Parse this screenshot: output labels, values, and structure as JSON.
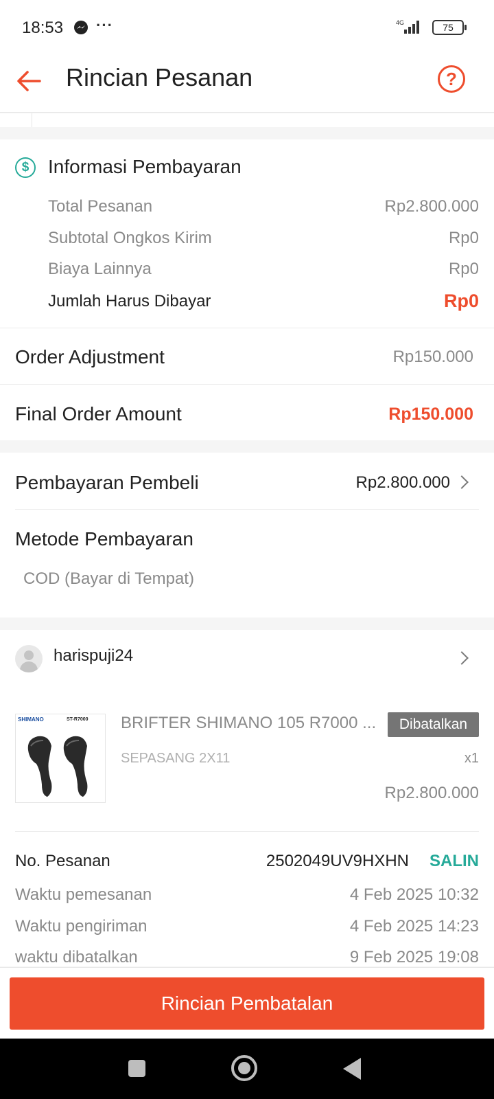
{
  "status_bar": {
    "time": "18:53",
    "extra": "···",
    "network": "4G",
    "battery": "75"
  },
  "header": {
    "title": "Rincian Pesanan"
  },
  "payment_info": {
    "title": "Informasi Pembayaran",
    "rows": [
      {
        "label": "Total Pesanan",
        "value": "Rp2.800.000"
      },
      {
        "label": "Subtotal Ongkos Kirim",
        "value": "Rp0"
      },
      {
        "label": "Biaya Lainnya",
        "value": "Rp0"
      },
      {
        "label": "Jumlah Harus Dibayar",
        "value": "Rp0"
      }
    ],
    "adjustment": {
      "label": "Order Adjustment",
      "value": "Rp150.000"
    },
    "final": {
      "label": "Final Order Amount",
      "value": "Rp150.000"
    },
    "buyer_payment": {
      "label": "Pembayaran Pembeli",
      "value": "Rp2.800.000"
    },
    "method": {
      "label": "Metode Pembayaran",
      "value": "COD (Bayar di Tempat)"
    }
  },
  "order": {
    "seller": "harispuji24",
    "product": {
      "thumb_brand": "SHIMANO",
      "thumb_model": "ST-R7000",
      "name": "BRIFTER SHIMANO 105 R7000 ...",
      "status": "Dibatalkan",
      "variant": "SEPASANG 2X11",
      "qty": "x1",
      "price": "Rp2.800.000"
    },
    "order_no_label": "No. Pesanan",
    "order_no": "2502049UV9HXHN",
    "copy_label": "SALIN",
    "times": [
      {
        "label": "Waktu pemesanan",
        "value": "4 Feb 2025 10:32"
      },
      {
        "label": "Waktu pengiriman",
        "value": "4 Feb 2025 14:23"
      },
      {
        "label": "waktu dibatalkan",
        "value": "9 Feb 2025 19:08"
      }
    ]
  },
  "footer": {
    "button": "Rincian Pembatalan"
  },
  "colors": {
    "accent": "#ee4d2d",
    "teal": "#26aa99",
    "badge": "#757575"
  }
}
